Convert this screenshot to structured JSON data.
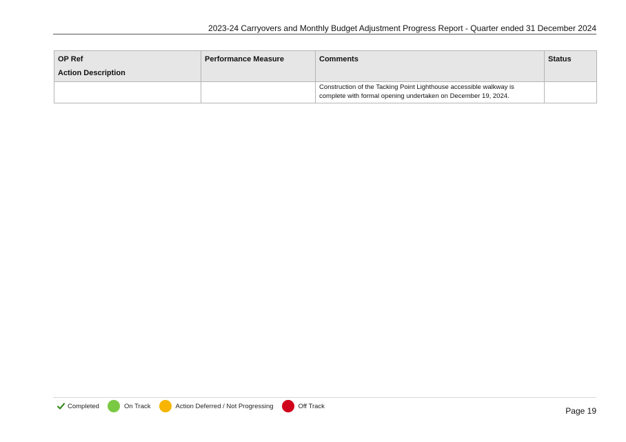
{
  "header": {
    "title": "2023-24 Carryovers and Monthly Budget Adjustment  Progress Report - Quarter ended 31 December 2024"
  },
  "table": {
    "columns": {
      "op_ref": "OP Ref",
      "action_description": "Action Description",
      "performance_measure": "Performance Measure",
      "comments": "Comments",
      "status": "Status"
    },
    "rows": [
      {
        "op_ref": "",
        "performance_measure": "",
        "comments_lines": [
          "Construction of the Tacking Point Lighthouse accessible walkway is",
          "complete with formal opening undertaken on December 19, 2024."
        ],
        "status": ""
      }
    ]
  },
  "legend": {
    "items": [
      {
        "label": "Completed",
        "icon": "check-icon",
        "color": "#3a8a1e"
      },
      {
        "label": "On Track",
        "icon": "green-dot-icon",
        "color": "#7ac943"
      },
      {
        "label": "Action Deferred / Not Progressing",
        "icon": "amber-dot-icon",
        "color": "#f7b500"
      },
      {
        "label": "Off Track",
        "icon": "red-dot-icon",
        "color": "#d0021b"
      }
    ]
  },
  "footer": {
    "page": "Page 19"
  }
}
